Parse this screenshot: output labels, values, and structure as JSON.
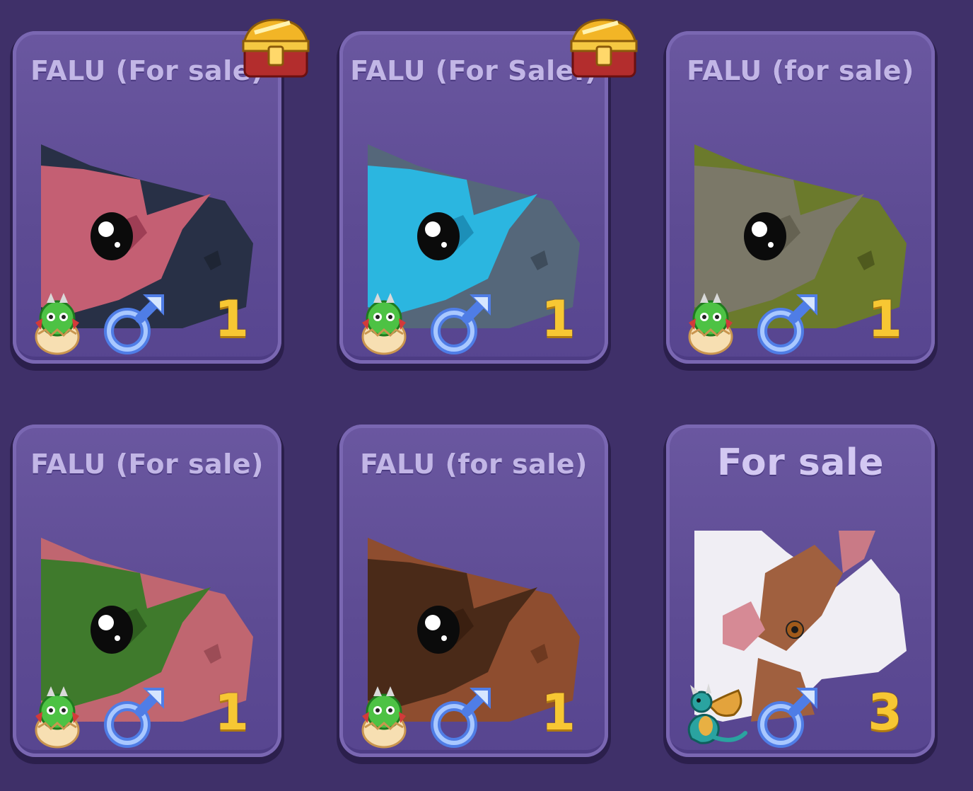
{
  "cards": [
    {
      "title": "FALU (For sale)",
      "count": "1",
      "gender": "male-icon",
      "badge": "baby-dragon-egg-icon",
      "premium": true,
      "colors": {
        "primary": "#c45f73",
        "secondary": "#283046"
      }
    },
    {
      "title": "FALU (For Sale.)",
      "count": "1",
      "gender": "male-icon",
      "badge": "baby-dragon-egg-icon",
      "premium": true,
      "colors": {
        "primary": "#2bb6e0",
        "secondary": "#55677a"
      }
    },
    {
      "title": "FALU (for sale)",
      "count": "1",
      "gender": "male-icon",
      "badge": "baby-dragon-egg-icon",
      "premium": false,
      "colors": {
        "primary": "#7b7868",
        "secondary": "#6b7a2c"
      }
    },
    {
      "title": "FALU (For sale)",
      "count": "1",
      "gender": "male-icon",
      "badge": "baby-dragon-egg-icon",
      "premium": false,
      "colors": {
        "primary": "#3f7a2c",
        "secondary": "#c06670"
      }
    },
    {
      "title": "FALU (for sale)",
      "count": "1",
      "gender": "male-icon",
      "badge": "baby-dragon-egg-icon",
      "premium": false,
      "colors": {
        "primary": "#4a2a18",
        "secondary": "#8e4d2f"
      }
    },
    {
      "title": "For sale",
      "count": "3",
      "gender": "male-icon",
      "badge": "adult-dragon-icon",
      "premium": false,
      "colors": {
        "primary": "#f0eef4",
        "secondary": "#a0603f"
      }
    }
  ]
}
